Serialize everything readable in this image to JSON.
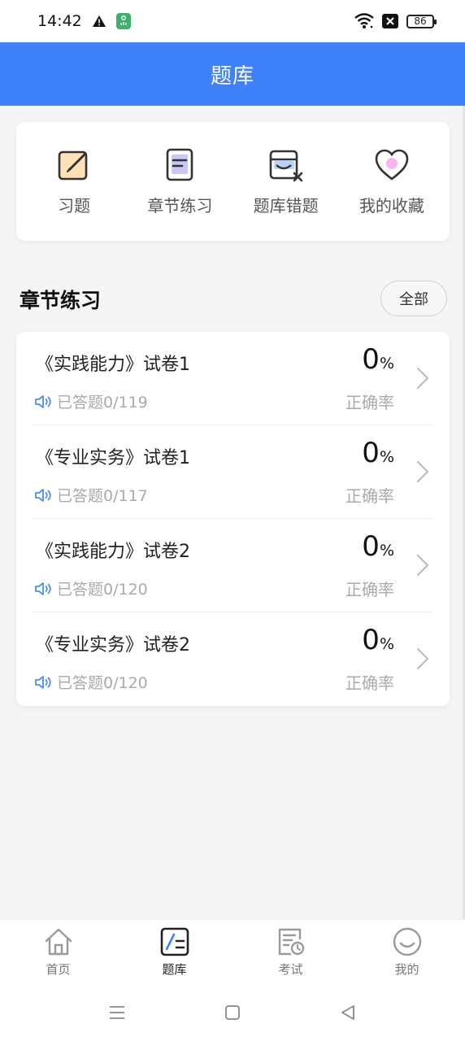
{
  "status_bar": {
    "time": "14:42",
    "battery": "86"
  },
  "header": {
    "title": "题库"
  },
  "quick_menu": [
    {
      "label": "习题",
      "icon": "edit-note-icon"
    },
    {
      "label": "章节练习",
      "icon": "document-icon"
    },
    {
      "label": "题库错题",
      "icon": "wrong-box-icon"
    },
    {
      "label": "我的收藏",
      "icon": "heart-icon"
    }
  ],
  "section": {
    "title": "章节练习",
    "all_label": "全部"
  },
  "papers": [
    {
      "title": "《实践能力》试卷1",
      "answered": "已答题0/119",
      "rate": "0",
      "rate_unit": "%",
      "rate_label": "正确率"
    },
    {
      "title": "《专业实务》试卷1",
      "answered": "已答题0/117",
      "rate": "0",
      "rate_unit": "%",
      "rate_label": "正确率"
    },
    {
      "title": "《实践能力》试卷2",
      "answered": "已答题0/120",
      "rate": "0",
      "rate_unit": "%",
      "rate_label": "正确率"
    },
    {
      "title": "《专业实务》试卷2",
      "answered": "已答题0/120",
      "rate": "0",
      "rate_unit": "%",
      "rate_label": "正确率"
    }
  ],
  "bottom_nav": [
    {
      "label": "首页",
      "icon": "home-icon"
    },
    {
      "label": "题库",
      "icon": "question-bank-icon"
    },
    {
      "label": "考试",
      "icon": "exam-icon"
    },
    {
      "label": "我的",
      "icon": "profile-icon"
    }
  ],
  "colors": {
    "primary": "#3f80fb",
    "muted_text": "#aaaaaa"
  }
}
